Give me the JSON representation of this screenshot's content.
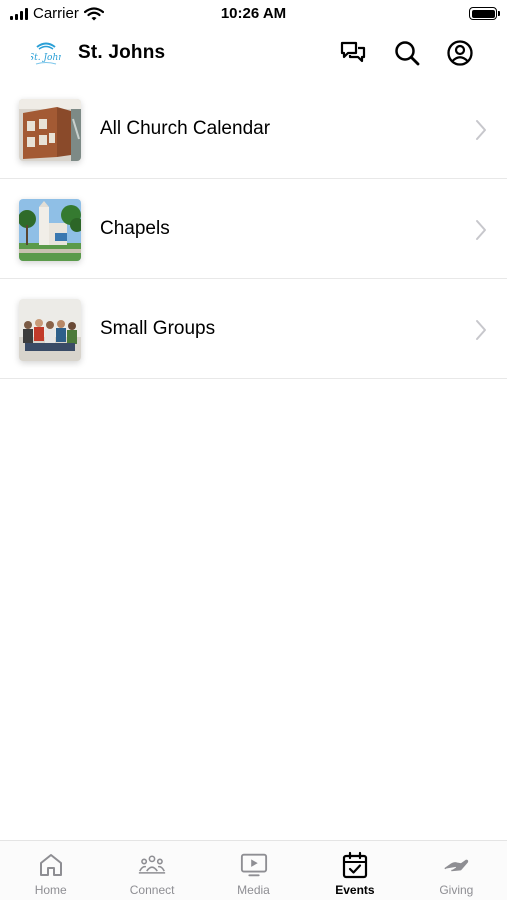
{
  "status_bar": {
    "carrier": "Carrier",
    "time": "10:26 AM"
  },
  "header": {
    "title": "St. Johns",
    "logo_text": "St. John",
    "icons": [
      "chat-icon",
      "search-icon",
      "account-icon"
    ]
  },
  "list": [
    {
      "label": "All Church Calendar",
      "thumbnail": "calendar-building-photo"
    },
    {
      "label": "Chapels",
      "thumbnail": "chapel-photo"
    },
    {
      "label": "Small Groups",
      "thumbnail": "small-group-photo"
    }
  ],
  "tabs": [
    {
      "label": "Home",
      "icon": "home-icon",
      "active": false
    },
    {
      "label": "Connect",
      "icon": "people-icon",
      "active": false
    },
    {
      "label": "Media",
      "icon": "play-screen-icon",
      "active": false
    },
    {
      "label": "Events",
      "icon": "calendar-icon",
      "active": true
    },
    {
      "label": "Giving",
      "icon": "hand-icon",
      "active": false
    }
  ],
  "colors": {
    "text": "#000000",
    "inactive_tab": "#8e8e93",
    "divider": "#e8e8e8",
    "chevron": "#c7c7cc",
    "logo_accent": "#2a9fd6"
  }
}
